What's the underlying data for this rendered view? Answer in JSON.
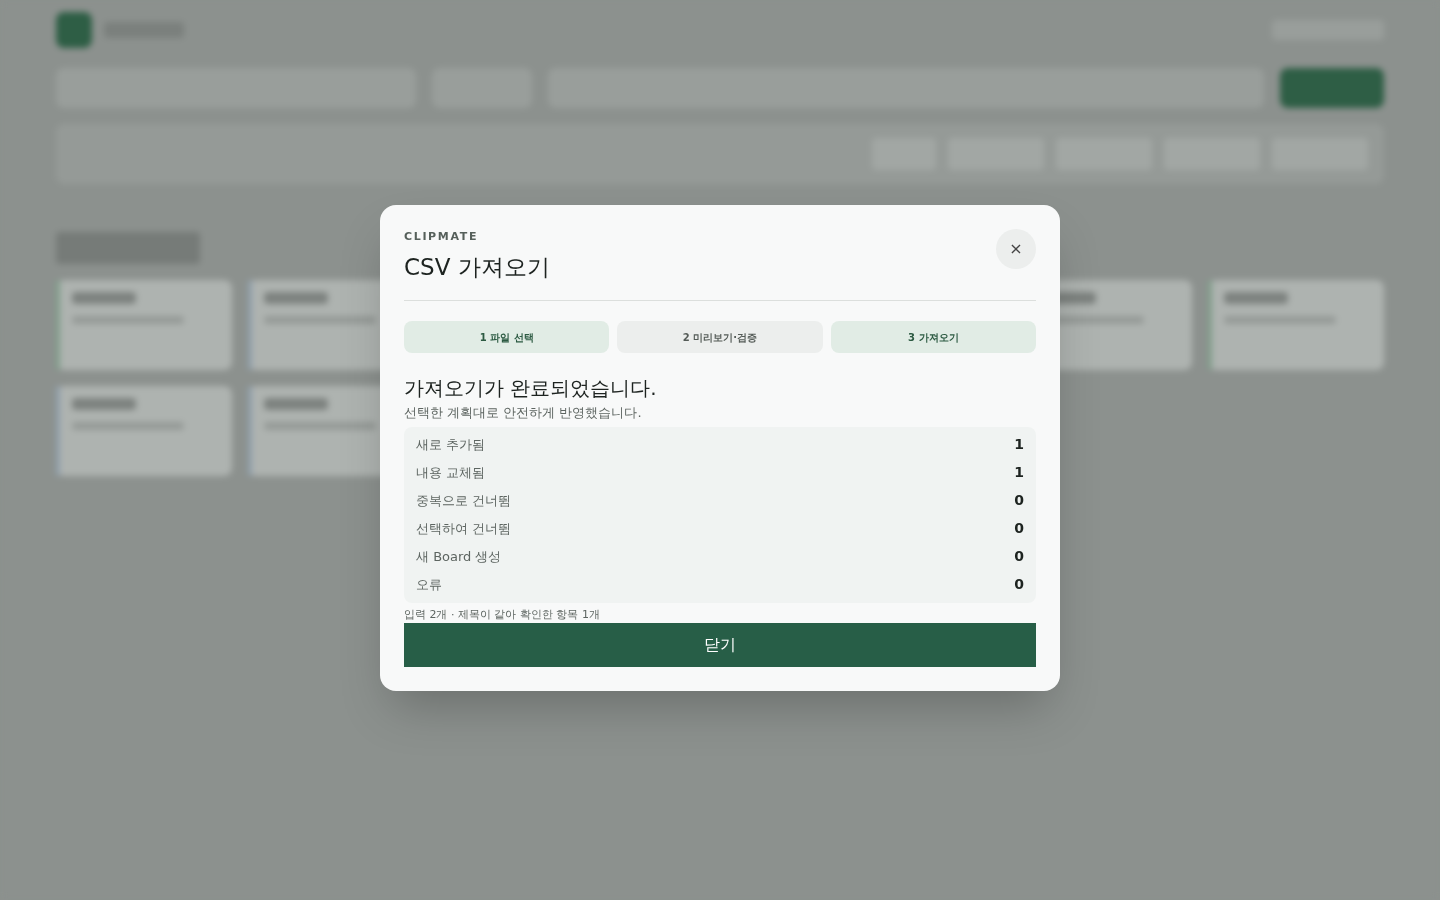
{
  "dialog": {
    "eyebrow": "CLIPMATE",
    "title": "CSV 가져오기",
    "close_icon": "×",
    "steps": [
      {
        "label": "1 파일 선택",
        "active": true
      },
      {
        "label": "2 미리보기·검증",
        "active": false
      },
      {
        "label": "3 가져오기",
        "active": true
      }
    ],
    "heading": "가져오기가 완료되었습니다.",
    "subtitle": "선택한 계획대로 안전하게 반영했습니다.",
    "summary": [
      {
        "label": "새로 추가됨",
        "value": "1"
      },
      {
        "label": "내용 교체됨",
        "value": "1"
      },
      {
        "label": "중복으로 건너뜀",
        "value": "0"
      },
      {
        "label": "선택하여 건너뜀",
        "value": "0"
      },
      {
        "label": "새 Board 생성",
        "value": "0"
      },
      {
        "label": "오류",
        "value": "0"
      }
    ],
    "note": "입력 2개 · 제목이 같아 확인한 항목 1개",
    "button": "닫기"
  }
}
